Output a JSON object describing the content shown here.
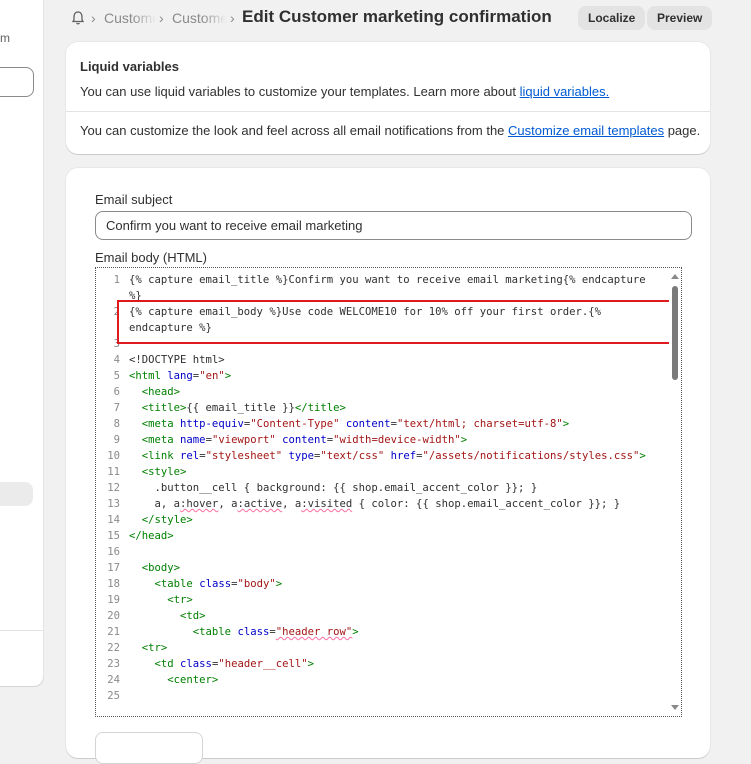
{
  "sidebar": {
    "fragment_text": "m"
  },
  "header": {
    "breadcrumbs": [
      "Customers",
      "Customer notifications"
    ],
    "title": "Edit Customer marketing confirmation",
    "localize_label": "Localize",
    "preview_label": "Preview"
  },
  "liquid_card": {
    "title": "Liquid variables",
    "text1_prefix": "You can use liquid variables to customize your templates. Learn more about ",
    "text1_link": "liquid variables.",
    "text2_prefix": "You can customize the look and feel across all email notifications from the ",
    "text2_link": "Customize email templates",
    "text2_suffix": " page."
  },
  "email_card": {
    "subject_label": "Email subject",
    "subject_value": "Confirm you want to receive email marketing",
    "body_label": "Email body (HTML)"
  },
  "editor": {
    "line_numbers": [
      "1",
      "2",
      "3",
      "4",
      "5",
      "6",
      "7",
      "8",
      "9",
      "10",
      "11",
      "12",
      "13",
      "14",
      "15",
      "16",
      "17",
      "18",
      "19",
      "20",
      "21",
      "22",
      "23",
      "24",
      "25"
    ],
    "l1a": "{% capture email_title %}Confirm you want to receive email marketing{% endcapture",
    "l1b": "%}",
    "l2a": "{% capture email_body %}Use code WELCOME10 for 10% off your first order.{%",
    "l2b": "endcapture %}",
    "doctype": "<!DOCTYPE html>",
    "t_html_open": "<html",
    "a_lang": "lang",
    "s_en": "\"en\"",
    "t_close": ">",
    "t_head": "<head>",
    "t_title_open": "<title>",
    "title_content": "{{ email_title }}",
    "t_title_close": "</title>",
    "t_meta": "<meta",
    "a_http_equiv": "http-equiv",
    "s_content_type": "\"Content-Type\"",
    "a_content": "content",
    "s_text_html": "\"text/html; charset=utf-8\"",
    "a_name": "name",
    "s_viewport": "\"viewport\"",
    "s_device_width": "\"width=device-width\"",
    "t_link": "<link",
    "a_rel": "rel",
    "s_stylesheet": "\"stylesheet\"",
    "a_type": "type",
    "s_text_css": "\"text/css\"",
    "a_href": "href",
    "s_href": "\"/assets/notifications/styles.css\"",
    "t_style": "<style>",
    "css1": ".button__cell { background: {{ shop.email_accent_color }}; }",
    "css2_a": "a, a",
    "css2_hover": ":hover",
    "css2_b": ", a",
    "css2_active": ":active",
    "css2_c": ", a",
    "css2_visited": ":visited",
    "css2_d": " { color: {{ shop.email_accent_color }}; }",
    "t_style_close": "</style>",
    "t_head_close": "</head>",
    "t_body": "<body>",
    "t_table": "<table",
    "a_class": "class",
    "s_body": "\"body\"",
    "t_tr": "<tr>",
    "t_td": "<td>",
    "s_header_row": "\"header row\"",
    "t_td_open": "<td",
    "s_header_cell": "\"header__cell\"",
    "t_center": "<center>",
    "eq": "="
  }
}
